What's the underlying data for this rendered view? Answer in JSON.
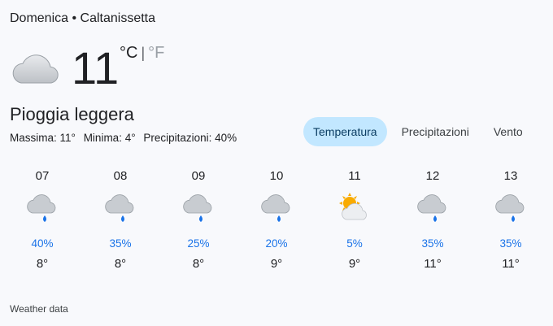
{
  "header": {
    "title": "Domenica • Caltanissetta"
  },
  "current": {
    "icon": "cloud-icon",
    "temperature": "11",
    "unit_c": "°C",
    "unit_sep": "|",
    "unit_f": "°F",
    "condition": "Pioggia leggera",
    "max": "Massima: 11°",
    "min": "Minima: 4°",
    "precip": "Precipitazioni: 40%"
  },
  "tabs": [
    {
      "label": "Temperatura",
      "active": true
    },
    {
      "label": "Precipitazioni",
      "active": false
    },
    {
      "label": "Vento",
      "active": false
    }
  ],
  "hours": [
    {
      "hour": "07",
      "icon": "rain-cloud-icon",
      "precip": "40%",
      "temp": "8°"
    },
    {
      "hour": "08",
      "icon": "rain-cloud-icon",
      "precip": "35%",
      "temp": "8°"
    },
    {
      "hour": "09",
      "icon": "rain-cloud-icon",
      "precip": "25%",
      "temp": "8°"
    },
    {
      "hour": "10",
      "icon": "rain-cloud-icon",
      "precip": "20%",
      "temp": "9°"
    },
    {
      "hour": "11",
      "icon": "partly-sunny-icon",
      "precip": "5%",
      "temp": "9°"
    },
    {
      "hour": "12",
      "icon": "rain-cloud-icon",
      "precip": "35%",
      "temp": "11°"
    },
    {
      "hour": "13",
      "icon": "rain-cloud-icon",
      "precip": "35%",
      "temp": "11°"
    }
  ],
  "footer": {
    "label": "Weather data"
  },
  "colors": {
    "accent": "#1a73e8",
    "tab_active_bg": "#c2e7ff",
    "rain_drop": "#1a73e8",
    "sun": "#f9ab00"
  }
}
